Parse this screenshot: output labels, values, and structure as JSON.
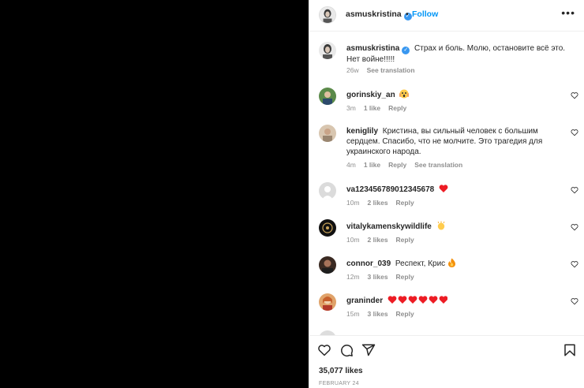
{
  "post": {
    "author": "asmuskristina",
    "follow_label": "Follow",
    "dot": "•",
    "more_icon": "more-horizontal-icon",
    "caption": "Страх и боль. Молю, остановите всё это. Нет войне!!!!!",
    "caption_time": "26w",
    "see_translation": "See translation",
    "likes": "35,077 likes",
    "date": "FEBRUARY 24"
  },
  "comments": [
    {
      "user": "gorinskiy_an",
      "text": "",
      "emoji": "scream-emoji",
      "time": "3m",
      "likes": "1 like",
      "reply": "Reply"
    },
    {
      "user": "keniglily",
      "text": "Кристина, вы сильный человек с большим сердцем. Спасибо, что не молчите. Это трагедия для украинского народа.",
      "time": "4m",
      "likes": "1 like",
      "reply": "Reply",
      "see_translation": "See translation"
    },
    {
      "user": "va12345678901234567​8",
      "text": "",
      "emoji": "red-heart-emoji",
      "time": "10m",
      "likes": "2 likes",
      "reply": "Reply"
    },
    {
      "user": "vitalykamenskywildlife",
      "text": "",
      "emoji": "clap-emoji",
      "time": "10m",
      "likes": "2 likes",
      "reply": "Reply"
    },
    {
      "user": "connor_039",
      "text": "Респект, Крис",
      "emoji": "fire-emoji",
      "time": "12m",
      "likes": "3 likes",
      "reply": "Reply"
    },
    {
      "user": "graninder",
      "text": "",
      "emoji": "six-red-hearts-emoji",
      "time": "15m",
      "likes": "3 likes",
      "reply": "Reply"
    }
  ],
  "colors": {
    "accent": "#0095f6",
    "verified": "#3897f0",
    "heart": "#ed1c24",
    "muted": "#8e8e8e"
  }
}
